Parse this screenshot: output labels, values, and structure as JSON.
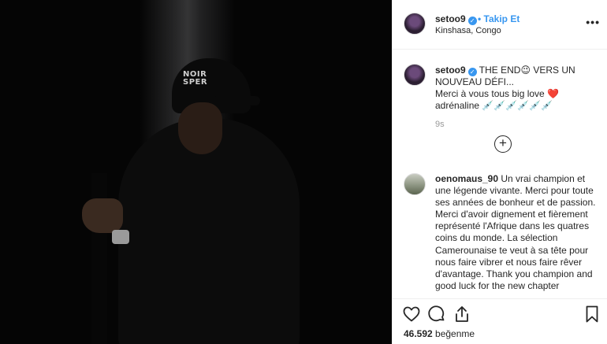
{
  "photo": {
    "cap_text_line1": "NOIR",
    "cap_text_line2": "SPER"
  },
  "header": {
    "username": "setoo9",
    "verified_icon": "✓",
    "separator": "•",
    "follow_label": "Takip Et",
    "location": "Kinshasa, Congo",
    "more_icon": "•••"
  },
  "caption": {
    "username": "setoo9",
    "text_line1": " THE END😉 VERS UN NOUVEAU DÉFI...",
    "text_line2": "Merci à vous tous big love ❤️",
    "text_line3": "adrénaline 💉💉💉💉💉💉",
    "time": "9s",
    "add_icon": "+"
  },
  "comment": {
    "username": "oenomaus_90",
    "text": " Un vrai champion et une légende vivante. Merci pour toute ses années de bonheur et de passion. Merci d'avoir dignement et fièrement représenté l'Afrique dans les quatres coins du monde. La sélection Camerounaise te veut à sa tête pour nous faire vibrer et nous faire rêver d'avantage. Thank you champion and good luck for the new chapter"
  },
  "actions": {
    "likes_count": "46.592",
    "likes_label": " beğenme"
  }
}
